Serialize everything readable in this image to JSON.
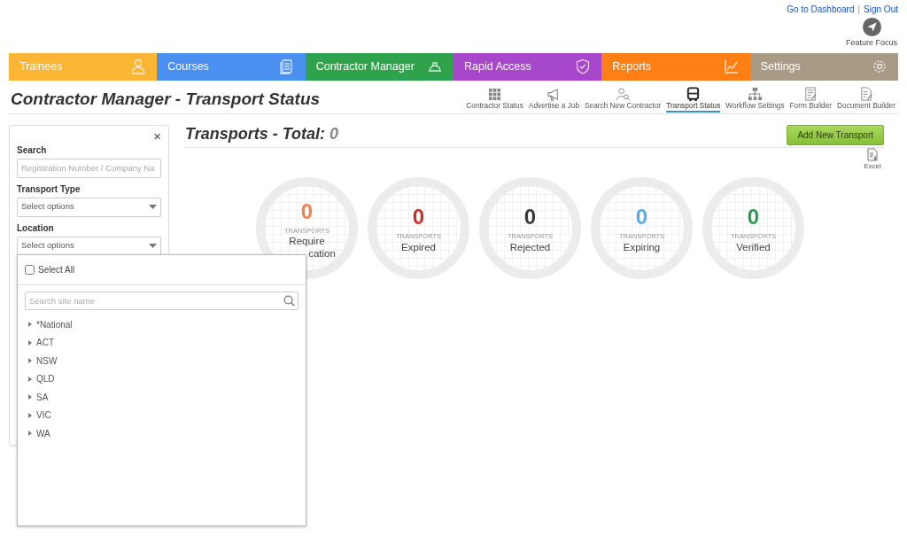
{
  "top_links": [
    "Go to Dashboard",
    "Sign Out"
  ],
  "top_links_separator": "|",
  "feature_focus": {
    "label": "Feature Focus"
  },
  "nav_tabs": [
    {
      "label": "Trainees",
      "color": "#fbb633"
    },
    {
      "label": "Courses",
      "color": "#4b8ff0"
    },
    {
      "label": "Contractor Manager",
      "color": "#2fa24b"
    },
    {
      "label": "Rapid Access",
      "color": "#a747c9"
    },
    {
      "label": "Reports",
      "color": "#ff7f14"
    },
    {
      "label": "Settings",
      "color": "#a99a86"
    }
  ],
  "page_title": "Contractor Manager - Transport Status",
  "tools": [
    {
      "label": "Contractor Status",
      "selected": false
    },
    {
      "label": "Advertise a Job",
      "selected": false
    },
    {
      "label": "Search New Contractor",
      "selected": false
    },
    {
      "label": "Transport Status",
      "selected": true
    },
    {
      "label": "Workflow Settings",
      "selected": false
    },
    {
      "label": "Form Builder",
      "selected": false
    },
    {
      "label": "Document Builder",
      "selected": false
    }
  ],
  "filters": {
    "close": "×",
    "search": {
      "label": "Search",
      "placeholder": "Registration Number / Company Na"
    },
    "transport_type": {
      "label": "Transport Type",
      "value": "Select options"
    },
    "location": {
      "label": "Location",
      "value": "Select options",
      "expanded": true
    }
  },
  "location_dropdown": {
    "select_all": {
      "label": "Select All",
      "checked": false
    },
    "search": {
      "placeholder": "Search site name"
    },
    "items": [
      {
        "label": "*National",
        "expanded": false
      },
      {
        "label": "ACT",
        "expanded": false
      },
      {
        "label": "NSW",
        "expanded": false
      },
      {
        "label": "QLD",
        "expanded": false
      },
      {
        "label": "SA",
        "expanded": false
      },
      {
        "label": "VIC",
        "expanded": false
      },
      {
        "label": "WA",
        "expanded": false
      }
    ]
  },
  "summary": {
    "title": "Transports - Total:",
    "total": "0"
  },
  "add_button": "Add New Transport",
  "export": {
    "label": "Excel"
  },
  "stats": [
    {
      "count": "0",
      "unit": "TRANSPORTS",
      "label_lines": [
        "Require",
        "cation"
      ],
      "color": "#f0844c"
    },
    {
      "count": "0",
      "unit": "TRANSPORTS",
      "label_lines": [
        "Expired"
      ],
      "color": "#c9302c"
    },
    {
      "count": "0",
      "unit": "TRANSPORTS",
      "label_lines": [
        "Rejected"
      ],
      "color": "#3a3a3a"
    },
    {
      "count": "0",
      "unit": "TRANSPORTS",
      "label_lines": [
        "Expiring"
      ],
      "color": "#5aade6"
    },
    {
      "count": "0",
      "unit": "TRANSPORTS",
      "label_lines": [
        "Verified"
      ],
      "color": "#2e9a52"
    }
  ]
}
